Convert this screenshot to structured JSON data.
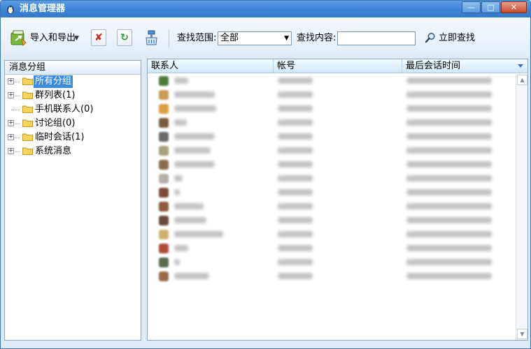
{
  "window": {
    "title": "消息管理器",
    "controls": {
      "minimize": "—",
      "maximize": "□",
      "close": "✕"
    }
  },
  "toolbar": {
    "import_export_label": "导入和导出",
    "search_range_label": "查找范围:",
    "search_range_value": "全部",
    "search_content_label": "查找内容:",
    "search_content_value": "",
    "search_button_label": "立即查找"
  },
  "groups": {
    "header": "消息分组",
    "items": [
      {
        "label": "所有分组",
        "selected": true,
        "expandable": true
      },
      {
        "label": "群列表(1)",
        "selected": false,
        "expandable": true
      },
      {
        "label": "手机联系人(0)",
        "selected": false,
        "expandable": false
      },
      {
        "label": "讨论组(0)",
        "selected": false,
        "expandable": true
      },
      {
        "label": "临时会话(1)",
        "selected": false,
        "expandable": true
      },
      {
        "label": "系统消息",
        "selected": false,
        "expandable": true
      }
    ]
  },
  "messages": {
    "columns": [
      "联系人",
      "帐号",
      "最后会话时间"
    ]
  },
  "colors": {
    "titlebar": "#3f86d6",
    "selection": "#3a8ce2",
    "header": "#cfe9fb"
  }
}
